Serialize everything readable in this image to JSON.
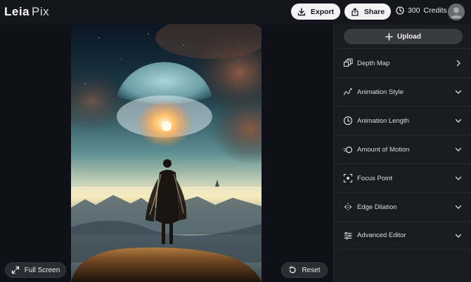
{
  "header": {
    "logo_main": "Leia",
    "logo_sub": "Pix",
    "export_label": "Export",
    "share_label": "Share",
    "credits_count": "300",
    "credits_label": "Credits"
  },
  "canvas": {
    "fullscreen_label": "Full Screen",
    "reset_label": "Reset"
  },
  "sidebar": {
    "upload_label": "Upload",
    "sections": [
      {
        "label": "Depth Map",
        "icon": "depth-map-icon",
        "chevron": "chevron-right-icon"
      },
      {
        "label": "Animation Style",
        "icon": "animation-style-icon",
        "chevron": "chevron-down-icon"
      },
      {
        "label": "Animation Length",
        "icon": "clock-icon",
        "chevron": "chevron-down-icon"
      },
      {
        "label": "Amount of Motion",
        "icon": "motion-icon",
        "chevron": "chevron-down-icon"
      },
      {
        "label": "Focus Point",
        "icon": "focus-point-icon",
        "chevron": "chevron-down-icon"
      },
      {
        "label": "Edge Dilation",
        "icon": "edge-dilation-icon",
        "chevron": "chevron-down-icon"
      },
      {
        "label": "Advanced Editor",
        "icon": "sliders-icon",
        "chevron": "chevron-down-icon"
      }
    ]
  },
  "colors": {
    "background": "#0f0f17",
    "sidebar": "#1a1a22",
    "pill_light": "#f3f3f5",
    "pill_dark": "#2b2b33"
  }
}
